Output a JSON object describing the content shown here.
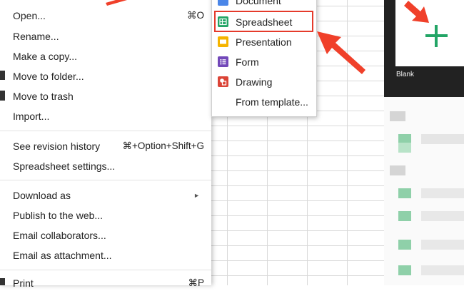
{
  "file_menu": {
    "items": [
      {
        "label": "Open...",
        "shortcut": "⌘O"
      },
      {
        "label": "Rename...",
        "shortcut": ""
      },
      {
        "label": "Make a copy...",
        "shortcut": ""
      },
      {
        "label": "Move to folder...",
        "shortcut": ""
      },
      {
        "label": "Move to trash",
        "shortcut": ""
      },
      {
        "label": "Import...",
        "shortcut": ""
      },
      {
        "label": "See revision history",
        "shortcut": "⌘+Option+Shift+G"
      },
      {
        "label": "Spreadsheet settings...",
        "shortcut": ""
      },
      {
        "label": "Download as",
        "shortcut": "►"
      },
      {
        "label": "Publish to the web...",
        "shortcut": ""
      },
      {
        "label": "Email collaborators...",
        "shortcut": ""
      },
      {
        "label": "Email as attachment...",
        "shortcut": ""
      },
      {
        "label": "Print",
        "shortcut": "⌘P"
      }
    ]
  },
  "new_menu": {
    "items": [
      {
        "label": "Document",
        "icon": "document-icon",
        "color": "#4a86e8"
      },
      {
        "label": "Spreadsheet",
        "icon": "spreadsheet-icon",
        "color": "#23a566"
      },
      {
        "label": "Presentation",
        "icon": "presentation-icon",
        "color": "#f5b400"
      },
      {
        "label": "Form",
        "icon": "form-icon",
        "color": "#7248b9"
      },
      {
        "label": "Drawing",
        "icon": "drawing-icon",
        "color": "#db4437"
      },
      {
        "label": "From template...",
        "icon": "",
        "color": ""
      }
    ]
  },
  "template_gallery": {
    "blank_label": "Blank"
  },
  "colors": {
    "highlight": "#e53a2b",
    "arrow": "#f0402a",
    "accent_green": "#23a566"
  }
}
